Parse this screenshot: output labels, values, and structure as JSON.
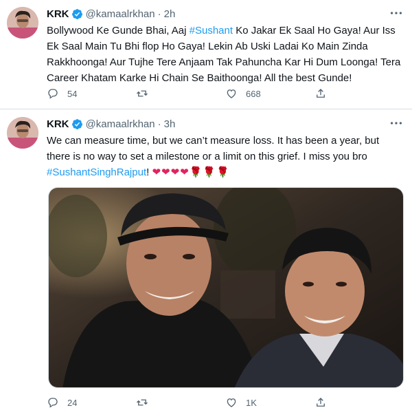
{
  "tweets": [
    {
      "name": "KRK",
      "handle": "@kamaalrkhan",
      "separator": "·",
      "time": "2h",
      "text_segments": [
        {
          "text": "Bollywood Ke Gunde Bhai, Aaj ",
          "type": "plain"
        },
        {
          "text": "#Sushant",
          "type": "hashtag"
        },
        {
          "text": " Ko Jakar Ek Saal Ho Gaya! Aur Iss Ek Saal Main Tu Bhi flop Ho Gaya! Lekin Ab Uski Ladai Ko Main Zinda Rakkhoonga! Aur Tujhe Tere Anjaam Tak Pahuncha Kar Hi Dum Loonga! Tera Career Khatam Karke Hi Chain Se Baithoonga! All the best Gunde!",
          "type": "plain"
        }
      ],
      "replies": "54",
      "retweets": "",
      "likes": "668"
    },
    {
      "name": "KRK",
      "handle": "@kamaalrkhan",
      "separator": "·",
      "time": "3h",
      "text_segments": [
        {
          "text": "We can measure time, but we can’t measure loss. It has been a year, but there is no way to set a milestone or a limit on this grief. I miss you bro ",
          "type": "plain"
        },
        {
          "text": "#SushantSinghRajput",
          "type": "hashtag"
        },
        {
          "text": "! ",
          "type": "plain"
        },
        {
          "text": "❤❤❤❤🌹🌹🌹",
          "type": "emoji"
        }
      ],
      "replies": "24",
      "retweets": "",
      "likes": "1K"
    }
  ],
  "colors": {
    "accent": "#1d9bf0",
    "text": "#0f1419",
    "muted": "#536471",
    "heart": "#e0245e",
    "divider": "#d9dde1"
  },
  "icons": {
    "verified": "verified-badge-icon",
    "more": "more-options-icon",
    "reply": "reply-icon",
    "retweet": "retweet-icon",
    "like": "like-icon",
    "share": "share-icon"
  }
}
